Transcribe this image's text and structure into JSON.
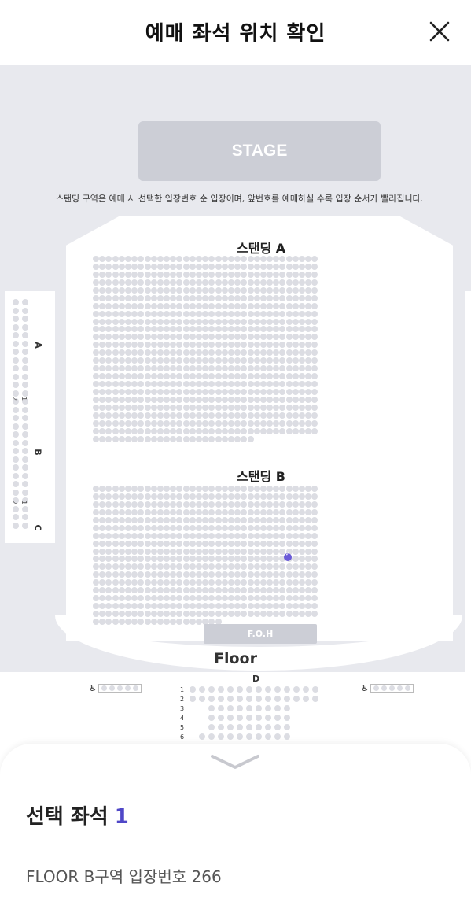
{
  "header": {
    "title": "예매 좌석 위치 확인",
    "close_icon": "close-icon"
  },
  "map": {
    "stage_label": "STAGE",
    "notice": "스탠딩 구역은 예매 시 선택한 입장번호 순 입장이며, 앞번호를 예매하실 수록 입장 순서가 빨라집니다.",
    "zone_a_label": "스탠딩 A",
    "zone_b_label": "스탠딩 B",
    "foh_label": "F.O.H",
    "floor_label": "Floor",
    "floor_block_label": "D",
    "side_labels": [
      "A",
      "B",
      "C"
    ],
    "side_numbers": [
      "1",
      "2",
      "1",
      "2"
    ],
    "floor_rows": [
      "1",
      "2",
      "3",
      "4",
      "5",
      "6"
    ],
    "wheelchair_icon": "wheelchair-icon",
    "selected_color": "#6a5ad8"
  },
  "sheet": {
    "handle_icon": "chevron-down-icon",
    "selected_label": "선택 좌석",
    "selected_count": "1",
    "seat_info": "FLOOR B구역 입장번호 266"
  }
}
